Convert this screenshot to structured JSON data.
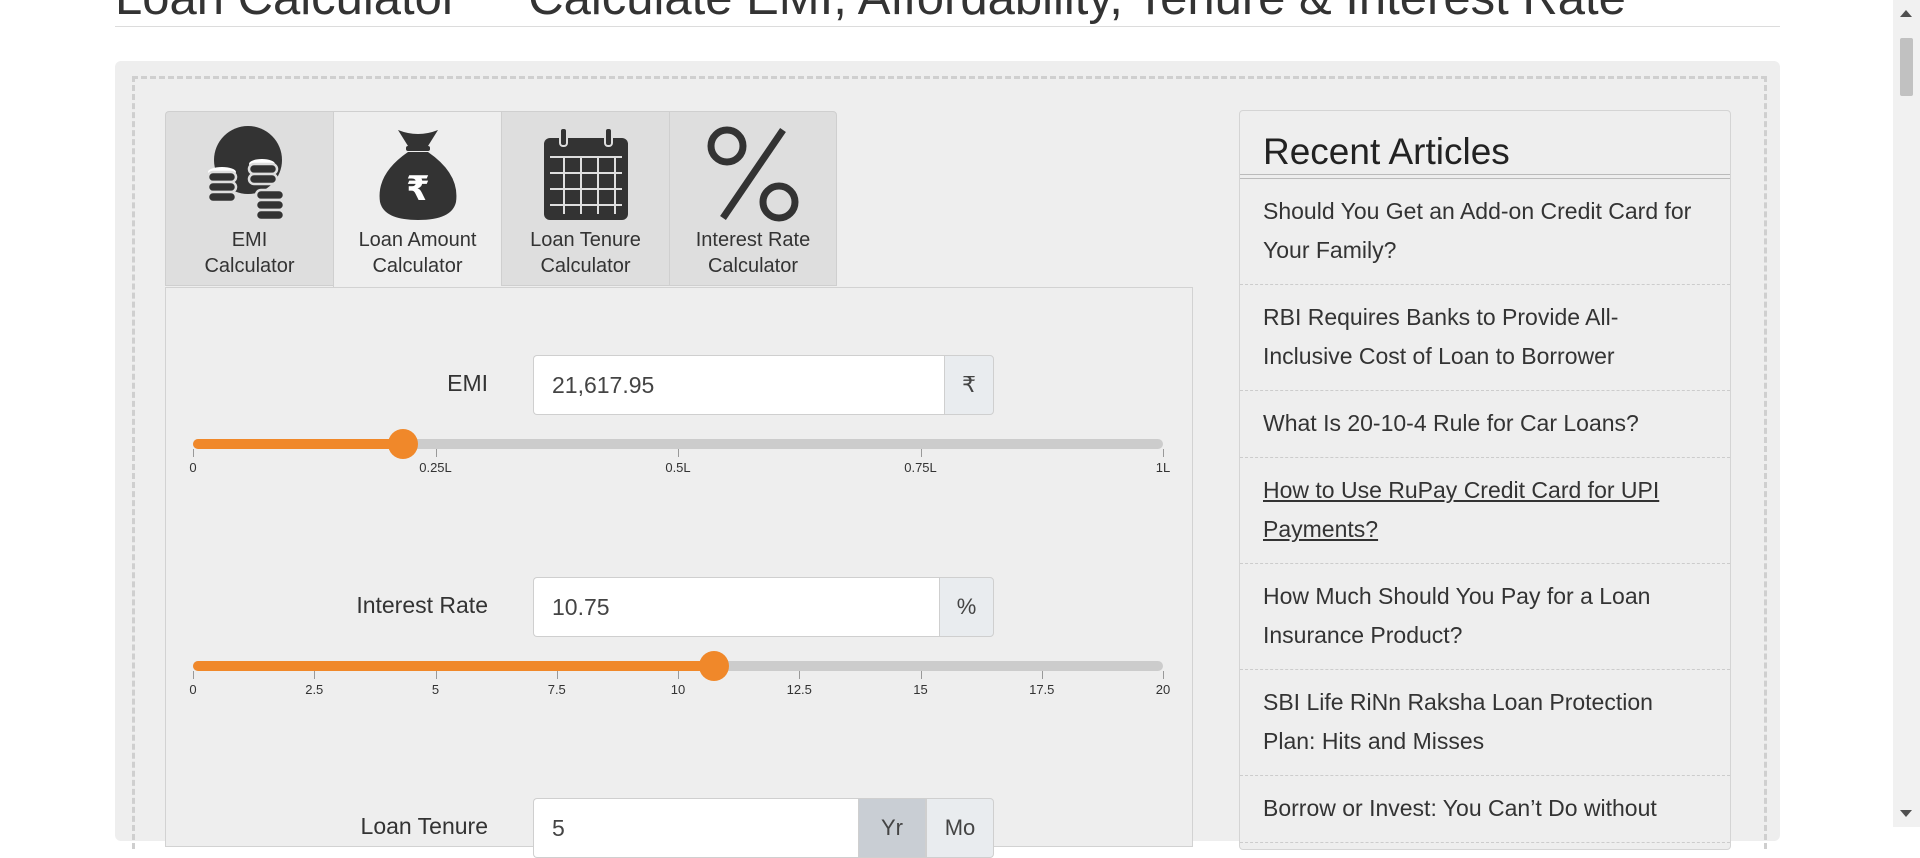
{
  "header": {
    "title": "Loan Calculator",
    "subtitle": "Calculate EMI, Affordability, Tenure & Interest Rate"
  },
  "tabs": [
    {
      "label": "EMI Calculator",
      "line1": "EMI",
      "line2": "Calculator",
      "icon": "coins-icon"
    },
    {
      "label": "Loan Amount Calculator",
      "line1": "Loan Amount",
      "line2": "Calculator",
      "icon": "money-bag-rupee-icon",
      "active": true
    },
    {
      "label": "Loan Tenure Calculator",
      "line1": "Loan Tenure",
      "line2": "Calculator",
      "icon": "calendar-icon"
    },
    {
      "label": "Interest Rate Calculator",
      "line1": "Interest Rate",
      "line2": "Calculator",
      "icon": "percent-icon"
    }
  ],
  "form": {
    "emi": {
      "label": "EMI",
      "value": "21,617.95",
      "unit": "₹",
      "slider_fraction": 0.216,
      "ticks": [
        "0",
        "0.25L",
        "0.5L",
        "0.75L",
        "1L"
      ]
    },
    "interest": {
      "label": "Interest Rate",
      "value": "10.75",
      "unit": "%",
      "slider_fraction": 0.5375,
      "ticks": [
        "0",
        "2.5",
        "5",
        "7.5",
        "10",
        "12.5",
        "15",
        "17.5",
        "20"
      ]
    },
    "tenure": {
      "label": "Loan Tenure",
      "value": "5",
      "unit_year": "Yr",
      "unit_month": "Mo"
    }
  },
  "sidebar": {
    "title": "Recent Articles",
    "articles": [
      "Should You Get an Add-on Credit Card for Your Family?",
      "RBI Requires Banks to Provide All-Inclusive Cost of Loan to Borrower",
      "What Is 20-10-4 Rule for Car Loans?",
      "How to Use RuPay Credit Card for UPI Payments?",
      "How Much Should You Pay for a Loan Insurance Product?",
      "SBI Life RiNn Raksha Loan Protection Plan: Hits and Misses",
      "Borrow or Invest: You Can’t Do without"
    ]
  },
  "colors": {
    "accent": "#f0882a",
    "track": "#cccccc",
    "panel": "#eeeeee"
  }
}
